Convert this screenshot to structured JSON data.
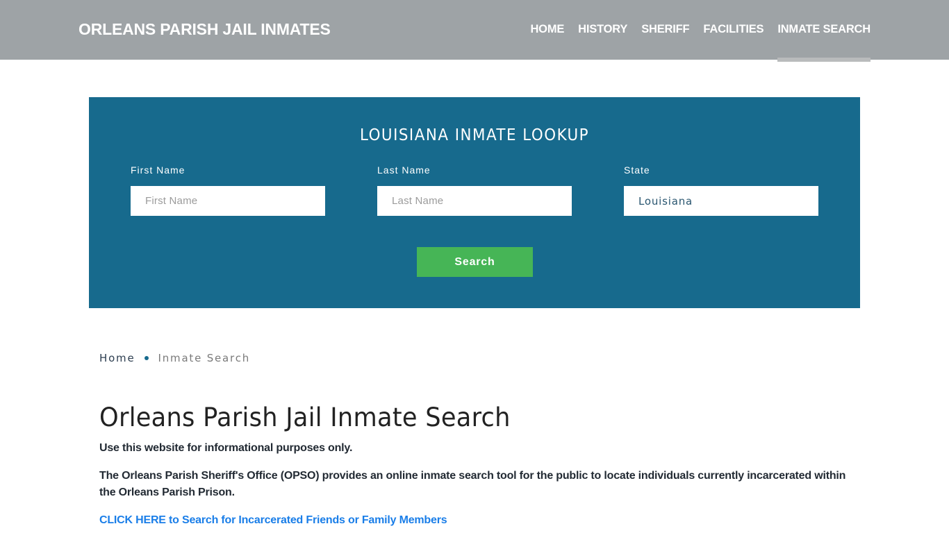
{
  "header": {
    "brand": "ORLEANS PARISH JAIL INMATES",
    "nav": [
      {
        "label": "HOME",
        "active": false
      },
      {
        "label": "HISTORY",
        "active": false
      },
      {
        "label": "SHERIFF",
        "active": false
      },
      {
        "label": "FACILITIES",
        "active": false
      },
      {
        "label": "INMATE SEARCH",
        "active": true
      }
    ]
  },
  "lookup": {
    "title": "LOUISIANA INMATE LOOKUP",
    "first_name": {
      "label": "First Name",
      "placeholder": "First Name",
      "value": ""
    },
    "last_name": {
      "label": "Last Name",
      "placeholder": "Last Name",
      "value": ""
    },
    "state": {
      "label": "State",
      "value": "Louisiana"
    },
    "search_label": "Search"
  },
  "breadcrumb": {
    "home": "Home",
    "current": "Inmate Search"
  },
  "content": {
    "title": "Orleans Parish Jail Inmate Search",
    "disclaimer": "Use this website for informational purposes only.",
    "description": "The Orleans Parish Sheriff's Office (OPSO) provides an online inmate search tool for the public to locate individuals currently incarcerated within the Orleans Parish Prison.",
    "cta_link": "CLICK HERE to Search for Incarcerated Friends or Family Members"
  },
  "colors": {
    "header_bg": "#9ea3a6",
    "lookup_bg": "#176a8d",
    "search_button": "#46b556",
    "link": "#1a7ee8"
  }
}
